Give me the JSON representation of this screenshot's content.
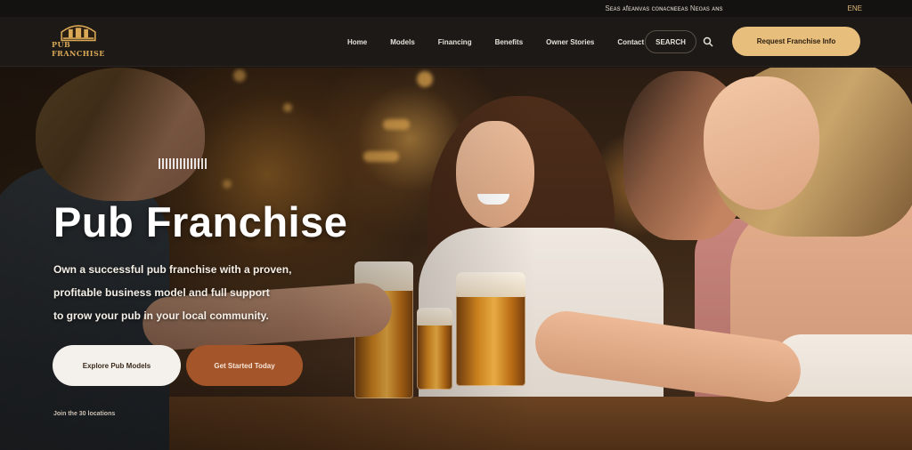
{
  "topbar": {
    "util_text": "Sᴇᴀs ᴀfᴇᴀɴᴠᴀs ᴄᴏɴᴀᴄɴᴇᴇᴀs Nᴇᴏᴀs ᴀɴs",
    "lang": "ENE"
  },
  "header": {
    "logo_text": "PUB FRANCHISE",
    "nav": [
      "Home",
      "Models",
      "Financing",
      "Benefits",
      "Owner Stories",
      "Contact"
    ],
    "search_label": "SEARCH",
    "cta_label": "Request Franchise Info"
  },
  "hero": {
    "title": "Pub Franchise",
    "body_lines": [
      "Own a successful pub franchise with a proven,",
      "profitable business model and full support",
      "to grow your pub in your local community."
    ],
    "primary_button": "Explore Pub Models",
    "secondary_button": "Get Started Today",
    "footnote": "Join the 30 locations"
  },
  "colors": {
    "accent": "#e8be7d",
    "secondary": "#a4552a",
    "nav_bg": "#1c1917"
  },
  "icons": {
    "search": "search-icon",
    "logo": "pub-logo-icon"
  }
}
